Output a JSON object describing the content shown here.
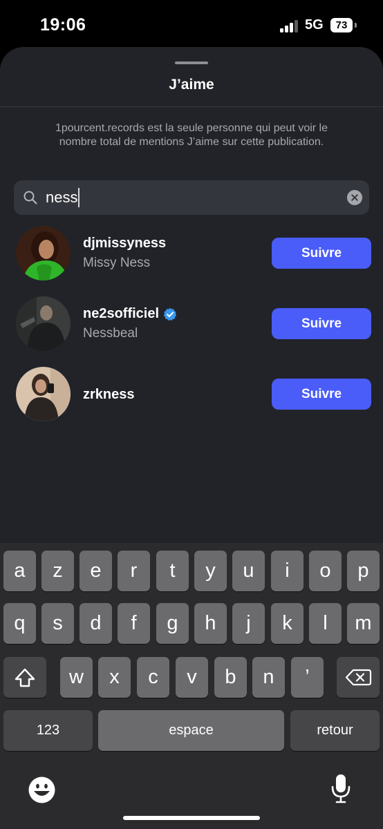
{
  "status_bar": {
    "time": "19:06",
    "network": "5G",
    "battery": "73"
  },
  "sheet": {
    "title": "J’aime",
    "privacy_note": "1pourcent.records est la seule personne qui peut voir le nombre total de mentions J’aime sur cette publication."
  },
  "search": {
    "value": "ness"
  },
  "users": [
    {
      "username": "djmissyness",
      "full_name": "Missy Ness",
      "verified": false,
      "button": "Suivre"
    },
    {
      "username": "ne2sofficiel",
      "full_name": "Nessbeal",
      "verified": true,
      "button": "Suivre"
    },
    {
      "username": "zrkness",
      "full_name": "",
      "verified": false,
      "button": "Suivre"
    }
  ],
  "keyboard": {
    "row1": [
      "a",
      "z",
      "e",
      "r",
      "t",
      "y",
      "u",
      "i",
      "o",
      "p"
    ],
    "row2": [
      "q",
      "s",
      "d",
      "f",
      "g",
      "h",
      "j",
      "k",
      "l",
      "m"
    ],
    "row3": [
      "w",
      "x",
      "c",
      "v",
      "b",
      "n",
      "’"
    ],
    "numbers_label": "123",
    "space_label": "espace",
    "return_label": "retour"
  },
  "colors": {
    "accent": "#4a5df9",
    "verified": "#3897f0",
    "sheet_bg": "#212329"
  }
}
